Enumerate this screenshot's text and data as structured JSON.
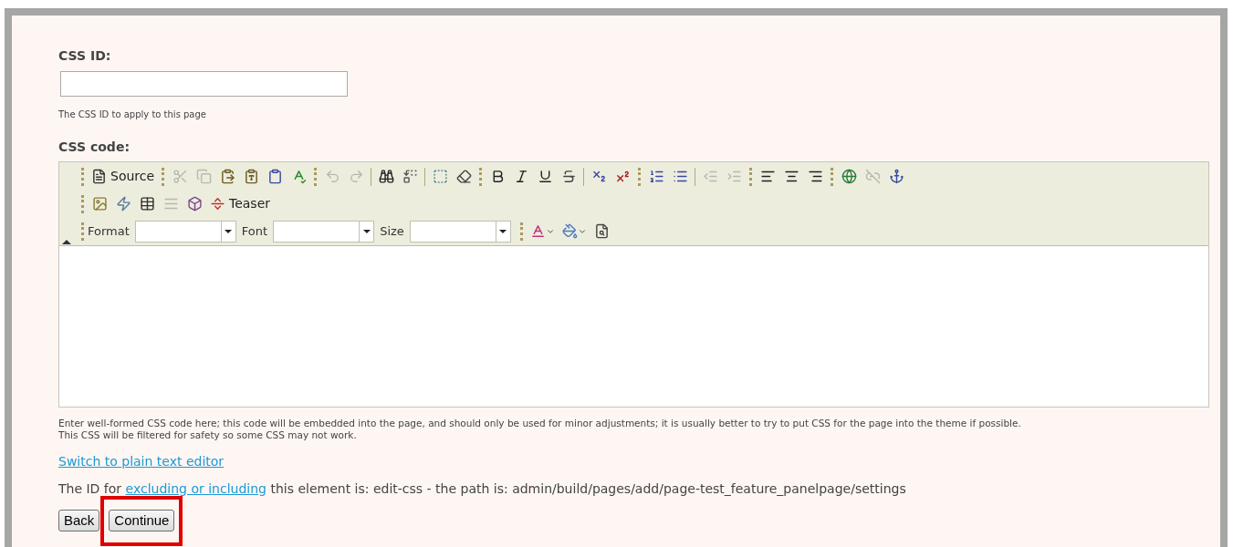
{
  "css_id": {
    "label": "CSS ID:",
    "help": "The CSS ID to apply to this page"
  },
  "css_code": {
    "label": "CSS code:",
    "toolbar": {
      "rows": [
        [
          {
            "kind": "grip"
          },
          {
            "kind": "text-button",
            "label": "Source",
            "disabled": false
          },
          {
            "kind": "grip"
          },
          {
            "kind": "button",
            "disabled": true
          },
          {
            "kind": "button",
            "disabled": true
          },
          {
            "kind": "button",
            "disabled": false
          },
          {
            "kind": "button",
            "disabled": false
          },
          {
            "kind": "button",
            "disabled": false
          },
          {
            "kind": "button",
            "disabled": false
          },
          {
            "kind": "grip"
          },
          {
            "kind": "button",
            "disabled": true
          },
          {
            "kind": "button",
            "disabled": true
          },
          {
            "kind": "divider"
          },
          {
            "kind": "button",
            "disabled": false
          },
          {
            "kind": "button",
            "disabled": false
          },
          {
            "kind": "divider"
          },
          {
            "kind": "button",
            "disabled": false
          },
          {
            "kind": "button",
            "disabled": false
          },
          {
            "kind": "grip"
          },
          {
            "kind": "button",
            "disabled": false
          },
          {
            "kind": "button",
            "disabled": false
          },
          {
            "kind": "button",
            "disabled": false
          },
          {
            "kind": "button",
            "disabled": false
          },
          {
            "kind": "divider"
          },
          {
            "kind": "button",
            "disabled": false
          },
          {
            "kind": "button",
            "disabled": false
          },
          {
            "kind": "grip"
          },
          {
            "kind": "button",
            "disabled": false
          },
          {
            "kind": "button",
            "disabled": false
          },
          {
            "kind": "divider"
          },
          {
            "kind": "button",
            "disabled": true
          },
          {
            "kind": "button",
            "disabled": true
          },
          {
            "kind": "grip"
          },
          {
            "kind": "button",
            "disabled": false
          },
          {
            "kind": "button",
            "disabled": false
          },
          {
            "kind": "button",
            "disabled": false
          },
          {
            "kind": "grip"
          },
          {
            "kind": "button",
            "disabled": false
          },
          {
            "kind": "button",
            "disabled": true
          },
          {
            "kind": "button",
            "disabled": false
          }
        ],
        [
          {
            "kind": "grip"
          },
          {
            "kind": "button",
            "disabled": false
          },
          {
            "kind": "button",
            "disabled": false
          },
          {
            "kind": "button",
            "disabled": false
          },
          {
            "kind": "button",
            "disabled": true
          },
          {
            "kind": "button",
            "disabled": false
          },
          {
            "kind": "text-button",
            "label": "Teaser",
            "disabled": false
          }
        ],
        [
          {
            "kind": "grip"
          },
          {
            "kind": "combo",
            "label": "Format"
          },
          {
            "kind": "combo",
            "label": "Font"
          },
          {
            "kind": "combo",
            "label": "Size"
          },
          {
            "kind": "grip"
          },
          {
            "kind": "menu-button",
            "disabled": false
          },
          {
            "kind": "menu-button",
            "disabled": false
          },
          {
            "kind": "button",
            "disabled": false
          }
        ]
      ]
    },
    "help": [
      "Enter well-formed CSS code here; this code will be embedded into the page, and should only be used for minor adjustments; it is usually better to try to put CSS for the page into the theme if possible.",
      "This CSS will be filtered for safety so some CSS may not work."
    ]
  },
  "switch_link": "Switch to plain text editor",
  "id_line": {
    "before": "The ID for ",
    "link": "excluding or including",
    "after": " this element is: edit-css - the path is: admin/build/pages/add/page-test_feature_panelpage/settings"
  },
  "buttons": [
    {
      "label": "Back",
      "highlighted": false
    },
    {
      "label": "Continue",
      "highlighted": true
    }
  ]
}
